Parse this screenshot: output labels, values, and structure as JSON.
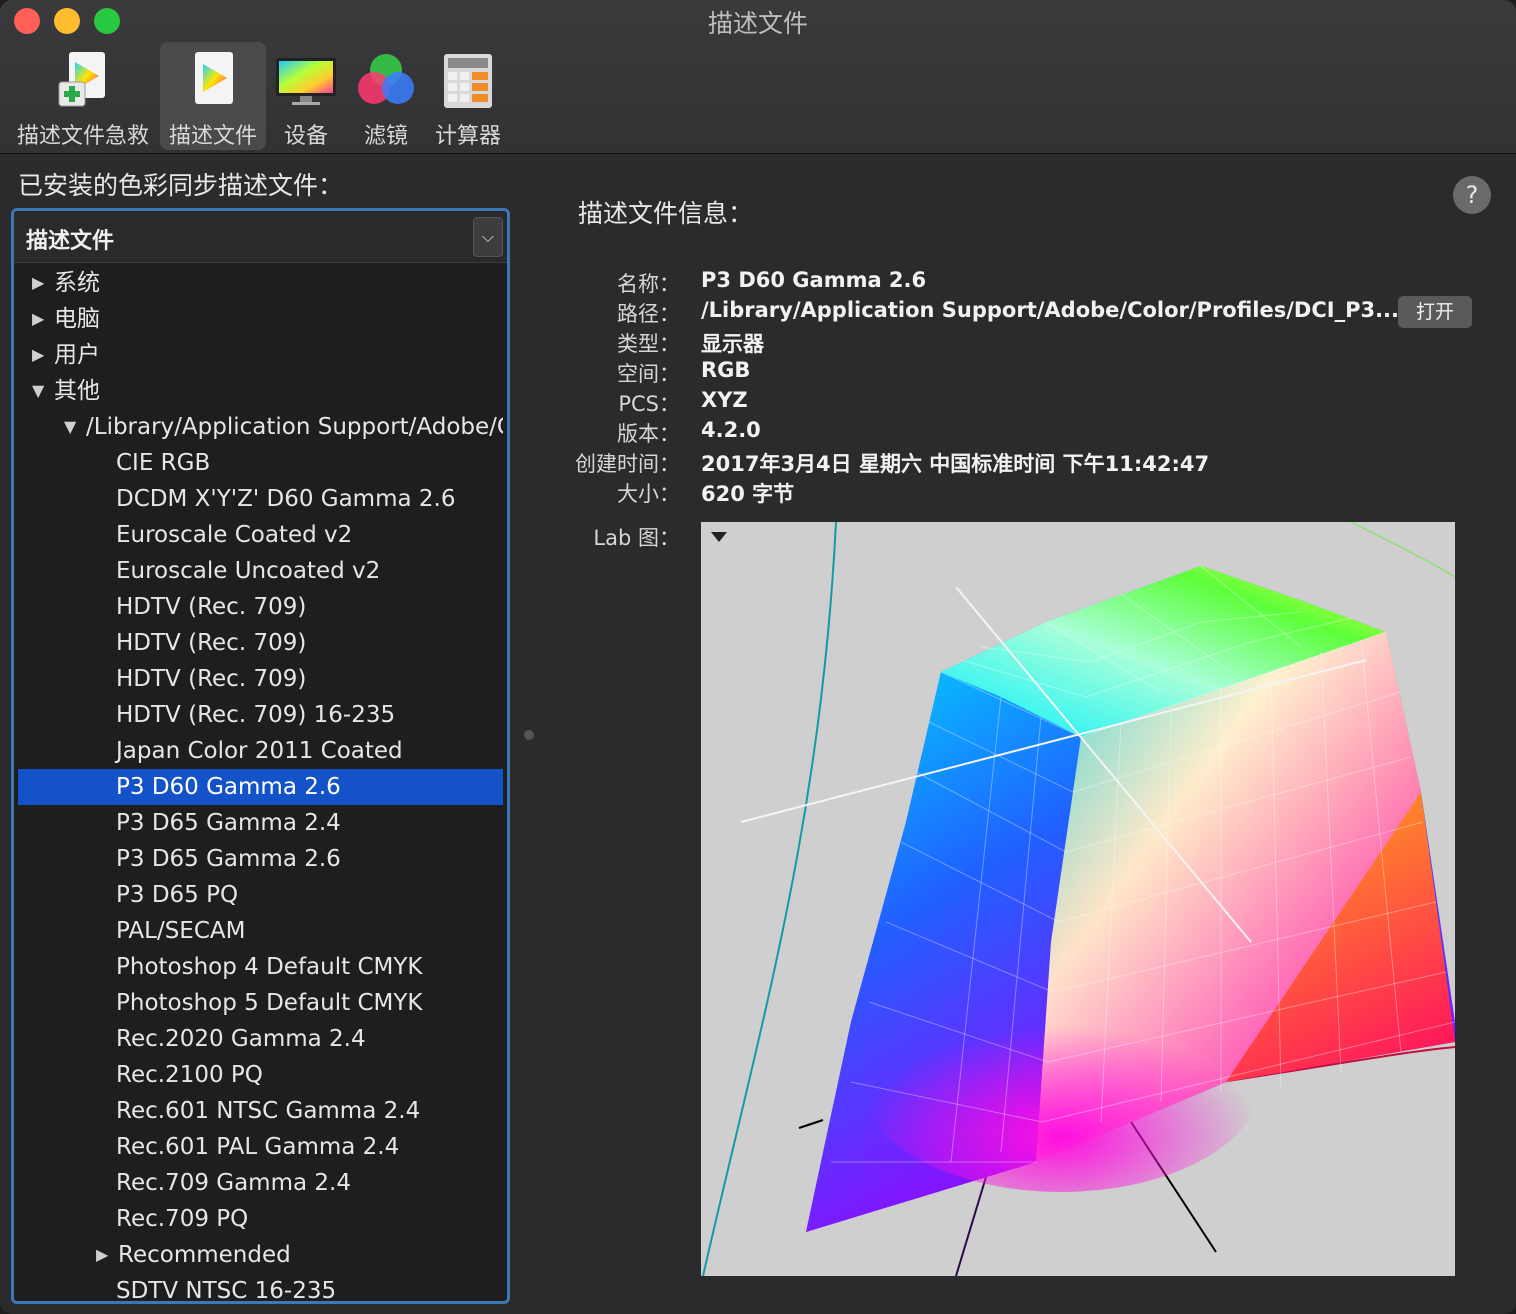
{
  "window": {
    "title": "描述文件"
  },
  "toolbar": {
    "items": [
      {
        "label": "描述文件急救",
        "icon": "profile-first-aid-icon"
      },
      {
        "label": "描述文件",
        "icon": "profile-icon",
        "selected": true
      },
      {
        "label": "设备",
        "icon": "display-device-icon"
      },
      {
        "label": "滤镜",
        "icon": "rgb-filter-icon"
      },
      {
        "label": "计算器",
        "icon": "calculator-icon"
      }
    ]
  },
  "left": {
    "installed_label": "已安装的色彩同步描述文件：",
    "header_label": "描述文件",
    "rows": [
      {
        "label": "系统",
        "disclosure": "closed",
        "indent": 0
      },
      {
        "label": "电脑",
        "disclosure": "closed",
        "indent": 0
      },
      {
        "label": "用户",
        "disclosure": "closed",
        "indent": 0
      },
      {
        "label": "其他",
        "disclosure": "open",
        "indent": 0
      },
      {
        "label": "/Library/Application Support/Adobe/C",
        "disclosure": "open",
        "indent": 1
      },
      {
        "label": "CIE RGB",
        "indent": 2
      },
      {
        "label": "DCDM X'Y'Z' D60 Gamma 2.6",
        "indent": 2
      },
      {
        "label": "Euroscale Coated v2",
        "indent": 2
      },
      {
        "label": "Euroscale Uncoated v2",
        "indent": 2
      },
      {
        "label": "HDTV (Rec. 709)",
        "indent": 2
      },
      {
        "label": "HDTV (Rec. 709)",
        "indent": 2
      },
      {
        "label": "HDTV (Rec. 709)",
        "indent": 2
      },
      {
        "label": "HDTV (Rec. 709) 16-235",
        "indent": 2
      },
      {
        "label": "Japan Color 2011 Coated",
        "indent": 2
      },
      {
        "label": "P3 D60 Gamma 2.6",
        "indent": 2,
        "selected": true
      },
      {
        "label": "P3 D65 Gamma 2.4",
        "indent": 2
      },
      {
        "label": "P3 D65 Gamma 2.6",
        "indent": 2
      },
      {
        "label": "P3 D65 PQ",
        "indent": 2
      },
      {
        "label": "PAL/SECAM",
        "indent": 2
      },
      {
        "label": "Photoshop 4 Default CMYK",
        "indent": 2
      },
      {
        "label": "Photoshop 5 Default CMYK",
        "indent": 2
      },
      {
        "label": "Rec.2020 Gamma 2.4",
        "indent": 2
      },
      {
        "label": "Rec.2100 PQ",
        "indent": 2
      },
      {
        "label": "Rec.601 NTSC Gamma 2.4",
        "indent": 2
      },
      {
        "label": "Rec.601 PAL Gamma 2.4",
        "indent": 2
      },
      {
        "label": "Rec.709 Gamma 2.4",
        "indent": 2
      },
      {
        "label": "Rec.709 PQ",
        "indent": 2
      },
      {
        "label": "Recommended",
        "disclosure": "closed",
        "indent": 1.7
      },
      {
        "label": "SDTV NTSC 16-235",
        "indent": 2
      }
    ]
  },
  "info": {
    "title": "描述文件信息：",
    "help": "?",
    "name_label": "名称：",
    "name": "P3 D60 Gamma 2.6",
    "path_label": "路径：",
    "path": "/Library/Application Support/Adobe/Color/Profiles/DCI_P3...",
    "open_button": "打开",
    "type_label": "类型：",
    "type": "显示器",
    "space_label": "空间：",
    "space": "RGB",
    "pcs_label": "PCS：",
    "pcs": "XYZ",
    "version_label": "版本：",
    "version": "4.2.0",
    "created_label": "创建时间：",
    "created": "2017年3月4日 星期六 中国标准时间 下午11:42:47",
    "size_label": "大小：",
    "size": "620 字节",
    "lab_label": "Lab 图：",
    "lab_menu": "▼"
  }
}
